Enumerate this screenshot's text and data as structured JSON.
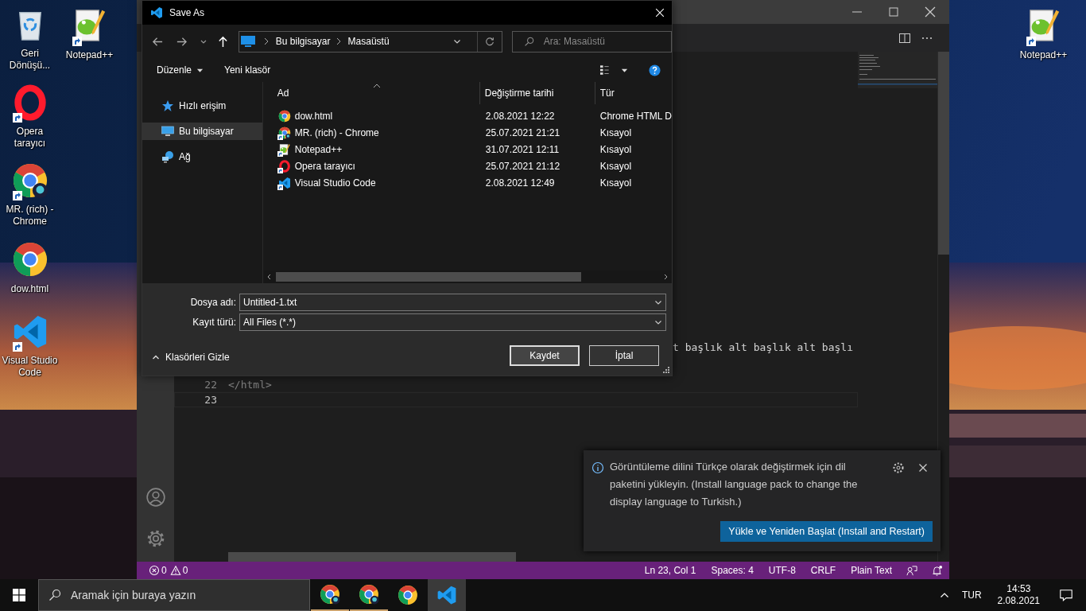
{
  "desktop": {
    "column_1": [
      {
        "label": "Geri Dönüşü...",
        "kind": "recycle",
        "shortcut": false
      },
      {
        "label": "Opera tarayıcı",
        "kind": "opera",
        "shortcut": true
      },
      {
        "label": "MR. (rich) - Chrome",
        "kind": "chrome-profile",
        "shortcut": true
      },
      {
        "label": "dow.html",
        "kind": "chrome",
        "shortcut": false
      },
      {
        "label": "Visual Studio Code",
        "kind": "vscode",
        "shortcut": true
      }
    ],
    "column_2": [
      {
        "label": "Notepad++",
        "kind": "notepad",
        "shortcut": true
      }
    ],
    "right_edge": [
      {
        "label": "Notepad++",
        "kind": "notepad",
        "shortcut": true
      }
    ]
  },
  "editor": {
    "partial_line": "t başlık alt başlık alt başlı",
    "lines": [
      {
        "number": "22",
        "text": "</html>",
        "current": false
      },
      {
        "number": "23",
        "current": true
      }
    ],
    "status_bar": {
      "errors": "0",
      "warnings": "0",
      "items": [
        "Ln 23, Col 1",
        "Spaces: 4",
        "UTF-8",
        "CRLF",
        "Plain Text"
      ]
    }
  },
  "notification": {
    "message": "Görüntüleme dilini Türkçe olarak değiştirmek için dil paketini yükleyin. (Install language pack to change the display language to Turkish.)",
    "button": "Yükle ve Yeniden Başlat (Install and Restart)"
  },
  "dialog": {
    "title": "Save As",
    "breadcrumb": [
      "Bu bilgisayar",
      "Masaüstü"
    ],
    "search": {
      "placeholder": "Ara: Masaüstü"
    },
    "toolbar": [
      {
        "label": "Düzenle",
        "kind": "menu"
      },
      {
        "label": "Yeni klasör",
        "kind": "button"
      }
    ],
    "nav_items": [
      {
        "label": "Hızlı erişim",
        "kind": "star",
        "selected": false
      },
      {
        "label": "Bu bilgisayar",
        "kind": "pc",
        "selected": true
      },
      {
        "label": "Ağ",
        "kind": "network",
        "selected": false
      }
    ],
    "columns": [
      "Ad",
      "Değiştirme tarihi",
      "Tür"
    ],
    "rows": [
      {
        "name": "dow.html",
        "date": "2.08.2021 12:22",
        "type": "Chrome HTML D",
        "kind": "chrome",
        "shortcut": false
      },
      {
        "name": "MR. (rich) - Chrome",
        "date": "25.07.2021 21:21",
        "type": "Kısayol",
        "kind": "chrome-profile",
        "shortcut": true
      },
      {
        "name": "Notepad++",
        "date": "31.07.2021 12:11",
        "type": "Kısayol",
        "kind": "notepad",
        "shortcut": true
      },
      {
        "name": "Opera tarayıcı",
        "date": "25.07.2021 21:12",
        "type": "Kısayol",
        "kind": "opera",
        "shortcut": true
      },
      {
        "name": "Visual Studio Code",
        "date": "2.08.2021 12:49",
        "type": "Kısayol",
        "kind": "vscode",
        "shortcut": true
      }
    ],
    "file_name": {
      "label": "Dosya adı:",
      "value": "Untitled-1.txt"
    },
    "file_type": {
      "label": "Kayıt türü:",
      "value": "All Files (*.*)"
    },
    "hide_folders": "Klasörleri Gizle",
    "buttons": [
      {
        "label": "Kaydet",
        "default": true
      },
      {
        "label": "İptal",
        "default": false
      }
    ]
  },
  "taskbar": {
    "search": {
      "placeholder": "Aramak için buraya yazın"
    },
    "apps": [
      {
        "kind": "chrome-profile",
        "running": true,
        "active": false
      },
      {
        "kind": "chrome-profile",
        "running": true,
        "active": false
      },
      {
        "kind": "chrome",
        "running": false,
        "active": false
      },
      {
        "kind": "vscode",
        "running": false,
        "active": true
      }
    ],
    "language": "TUR",
    "time": "14:53",
    "date": "2.08.2021"
  }
}
